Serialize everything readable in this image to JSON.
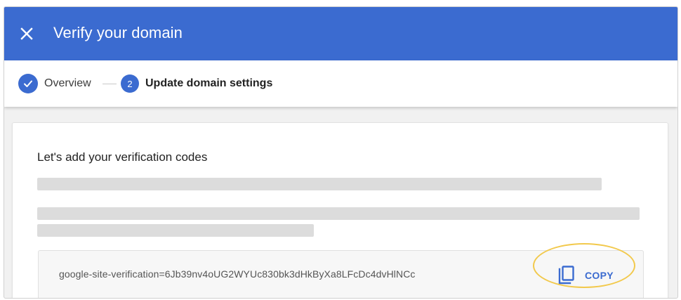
{
  "header": {
    "title": "Verify your domain",
    "close_icon": "close-icon",
    "background_color": "#3b6bd0"
  },
  "stepper": {
    "steps": [
      {
        "label": "Overview",
        "state": "completed",
        "icon": "check-icon"
      },
      {
        "number": "2",
        "label": "Update domain settings",
        "state": "active"
      }
    ]
  },
  "card": {
    "heading": "Let's add your verification codes",
    "verification_code": "google-site-verification=6Jb39nv4oUG2WYUc830bk3dHkByXa8LFcDc4dvHlNCc",
    "copy_button": {
      "label": "COPY",
      "icon": "copy-icon"
    }
  },
  "colors": {
    "accent": "#3b6bd0",
    "highlight": "#f2c94c",
    "placeholder": "#dcdcdc"
  }
}
